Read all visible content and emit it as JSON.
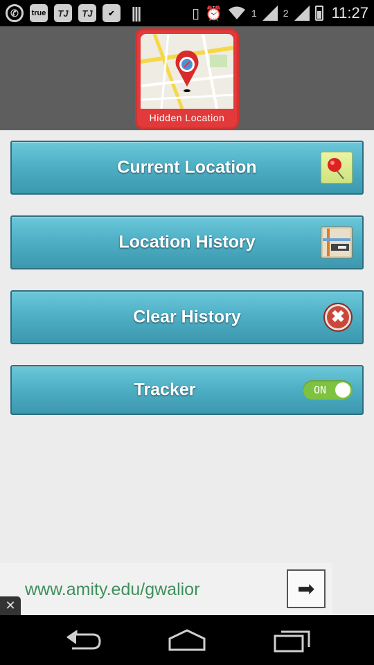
{
  "status_bar": {
    "icons": [
      "whatsapp-icon",
      "true-icon",
      "tj-icon",
      "tj-icon",
      "check-icon",
      "barcode-icon",
      "vibrate-icon",
      "alarm-icon",
      "wifi-icon",
      "signal-icon",
      "signal-icon",
      "battery-charging-icon"
    ],
    "true_label": "true",
    "tj_label": "TJ",
    "sim1": "1",
    "sim2": "2",
    "time": "11:27"
  },
  "header": {
    "app_name": "Hidden Location",
    "logo_icon": "map-pin-logo-icon"
  },
  "buttons": [
    {
      "label": "Current Location",
      "icon": "pushpin-icon"
    },
    {
      "label": "Location History",
      "icon": "map-book-icon"
    },
    {
      "label": "Clear History",
      "icon": "close-circle-icon"
    },
    {
      "label": "Tracker",
      "icon": "toggle-switch",
      "toggle_state": "ON",
      "toggle_on": true
    }
  ],
  "ad": {
    "text": "www.amity.edu/gwalior",
    "arrow_icon": "arrow-right-icon",
    "close_icon": "close-icon"
  },
  "nav_bar": {
    "icons": [
      "back-icon",
      "home-icon",
      "recents-icon"
    ]
  },
  "colors": {
    "button_top": "#6cc8da",
    "button_bottom": "#3c98ae",
    "header_bg": "#5e5e5e",
    "logo_red": "#e23a3a",
    "toggle_green": "#7fc241",
    "ad_text": "#3f8f5d"
  }
}
